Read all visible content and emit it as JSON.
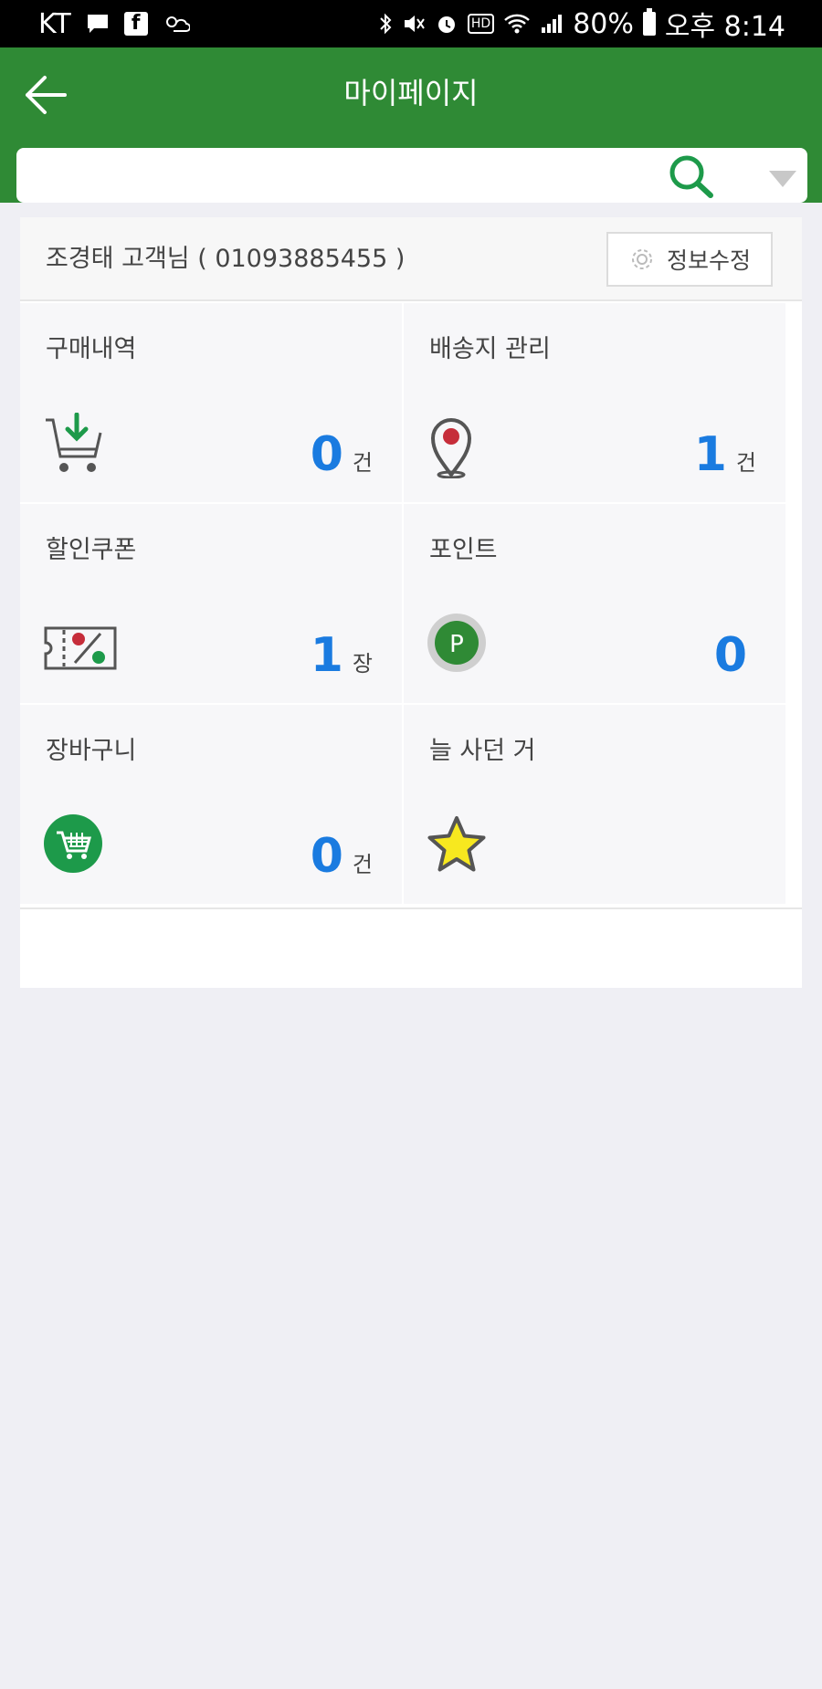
{
  "status_bar": {
    "carrier": "KT",
    "battery_percent": "80%",
    "time_label": "오후 8:14",
    "hd_label": "HD"
  },
  "header": {
    "title": "마이페이지",
    "back_icon": "arrow-left-icon"
  },
  "search": {
    "placeholder": "",
    "search_icon": "search-icon",
    "dropdown_icon": "dropdown-triangle-icon"
  },
  "user": {
    "greeting": "조경태 고객님 ( 01093885455 )",
    "edit_button_label": "정보수정"
  },
  "tiles": [
    {
      "label": "구매내역",
      "count": "0",
      "unit": "건",
      "icon": "cart-download-icon"
    },
    {
      "label": "배송지 관리",
      "count": "1",
      "unit": "건",
      "icon": "location-pin-icon"
    },
    {
      "label": "할인쿠폰",
      "count": "1",
      "unit": "장",
      "icon": "coupon-icon"
    },
    {
      "label": "포인트",
      "count": "0",
      "unit": "",
      "icon": "point-badge-icon"
    },
    {
      "label": "장바구니",
      "count": "0",
      "unit": "건",
      "icon": "shopping-basket-icon"
    },
    {
      "label": "늘 사던 거",
      "count": "",
      "unit": "",
      "icon": "star-icon"
    }
  ],
  "colors": {
    "header_green": "#2f8a35",
    "count_blue": "#1a7be0",
    "background": "#efeff4"
  }
}
